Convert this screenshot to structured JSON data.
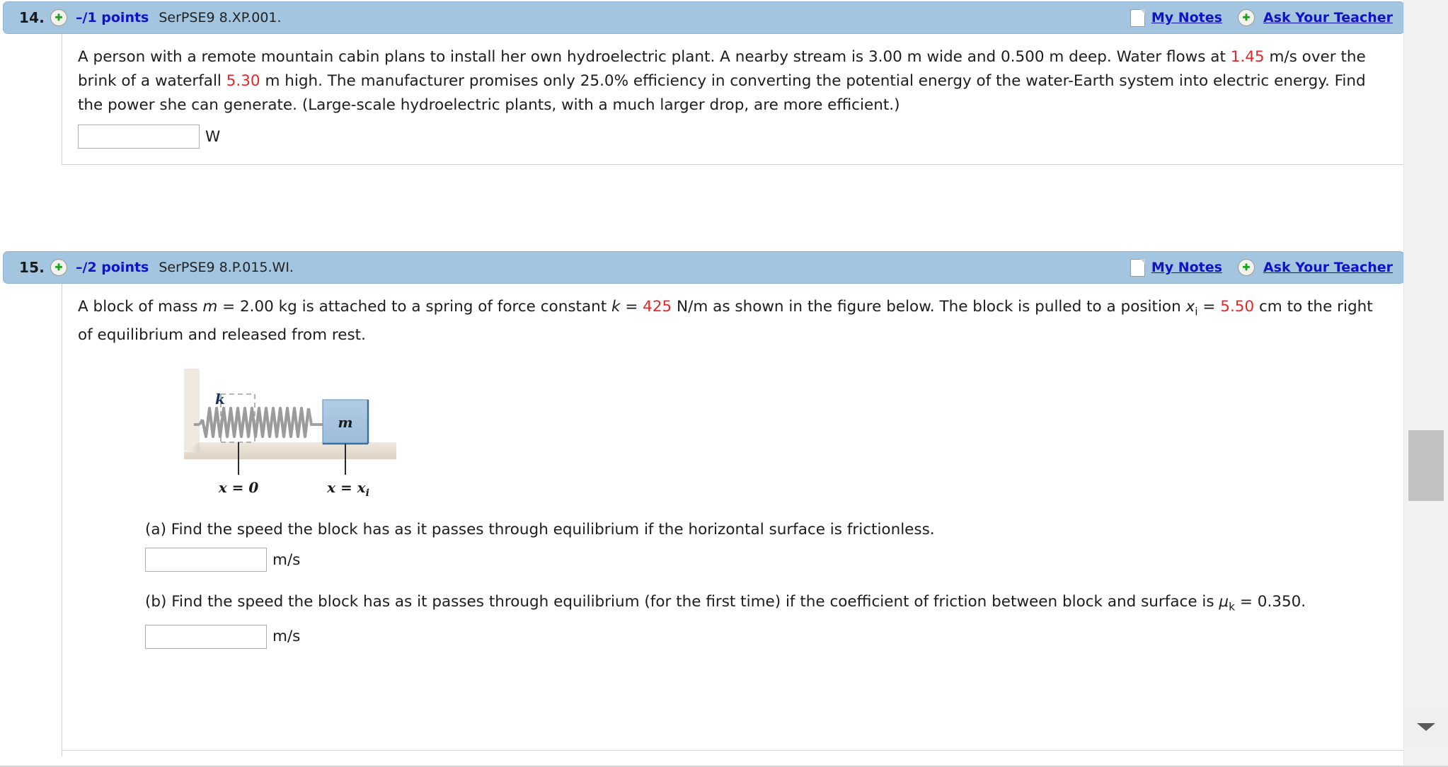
{
  "app": {
    "accent_header_bg": "#a3c5e0",
    "link_color": "#1111cc",
    "highlight_value_color": "#e8262a"
  },
  "problems": [
    {
      "number": "14.",
      "points": "–/1 points",
      "code": "SerPSE9 8.XP.001.",
      "my_notes": "My Notes",
      "ask_teacher": "Ask Your Teacher",
      "statement_parts": [
        {
          "t": "A person with a remote mountain cabin plans to install her own hydroelectric plant. A nearby stream is 3.00 m wide and 0.500 m deep. Water flows at ",
          "s": "plain"
        },
        {
          "t": "1.45",
          "s": "red"
        },
        {
          "t": " m/s over the brink of a waterfall ",
          "s": "plain"
        },
        {
          "t": "5.30",
          "s": "red"
        },
        {
          "t": " m high. The manufacturer promises only 25.0% efficiency in converting the potential energy of the water-Earth system into electric energy. Find the power she can generate. (Large-scale hydroelectric plants, with a much larger drop, are more efficient.)",
          "s": "plain"
        }
      ],
      "answer_value": "",
      "answer_unit": "W"
    },
    {
      "number": "15.",
      "points": "–/2 points",
      "code": "SerPSE9 8.P.015.WI.",
      "my_notes": "My Notes",
      "ask_teacher": "Ask Your Teacher",
      "answer_a_value": "",
      "answer_a_unit": "m/s",
      "answer_b_value": "",
      "answer_b_unit": "m/s"
    }
  ],
  "figure": {
    "spring_label": "k",
    "block_label": "m",
    "tick_left_label": "x = 0",
    "tick_right_label": "x = x",
    "tick_right_sub": "i",
    "block_fill": "#a9c5e0",
    "block_stroke": "#3c6f9e",
    "wall_fill": "#e9e2d8",
    "floor_fill": "#e6ded2",
    "spring_color": "#9b9b9b"
  },
  "scrollbar": {
    "down_arrow_icon": "chevron-down-icon"
  }
}
